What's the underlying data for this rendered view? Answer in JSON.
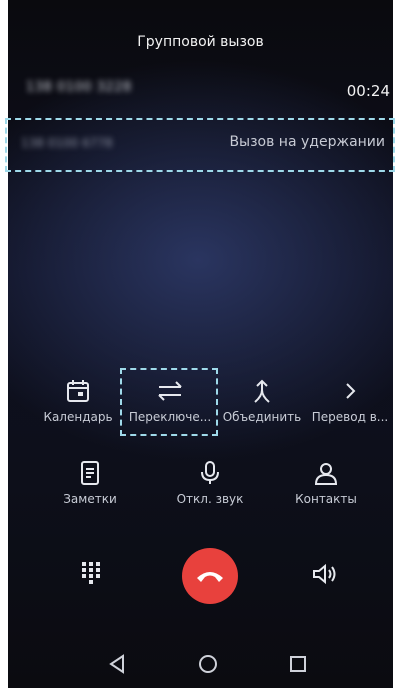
{
  "call": {
    "title": "Групповой вызов",
    "active_number": "138 0100 3228",
    "timer": "00:24",
    "held_number": "138 0100 6778",
    "held_status": "Вызов на удержании"
  },
  "actions_row1": [
    {
      "label": "Календарь",
      "icon": "calendar-icon"
    },
    {
      "label": "Переключе...",
      "icon": "swap-icon"
    },
    {
      "label": "Объединить",
      "icon": "merge-icon"
    },
    {
      "label": "Перевод в...",
      "icon": "chevron-right-icon"
    }
  ],
  "actions_row2": [
    {
      "label": "Заметки",
      "icon": "notes-icon"
    },
    {
      "label": "Откл. звук",
      "icon": "microphone-icon"
    },
    {
      "label": "Контакты",
      "icon": "contacts-icon"
    }
  ],
  "controls": {
    "dialpad_icon": "dialpad-icon",
    "end_call_icon": "end-call-icon",
    "speaker_icon": "speaker-icon"
  },
  "colors": {
    "end_call": "#e8413d",
    "highlight": "#9fdaea"
  }
}
